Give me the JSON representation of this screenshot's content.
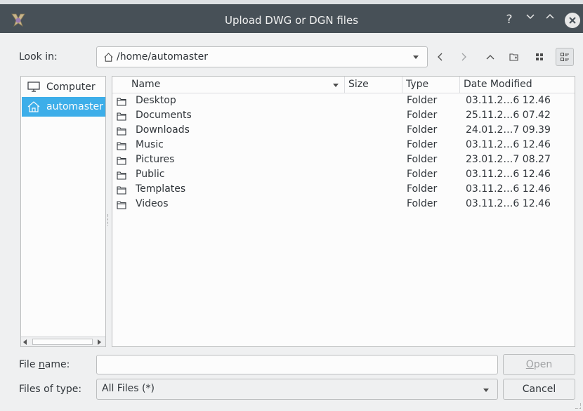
{
  "window": {
    "title": "Upload DWG or DGN files",
    "help_glyph": "?",
    "minimize_glyph": "⌄",
    "maximize_glyph": "⌃"
  },
  "lookin": {
    "label": "Look in:",
    "path": "/home/automaster"
  },
  "sidebar": {
    "items": [
      {
        "label": "Computer",
        "icon": "computer-icon"
      },
      {
        "label": "automaster",
        "icon": "home-icon"
      }
    ]
  },
  "filelist": {
    "columns": [
      "Name",
      "Size",
      "Type",
      "Date Modified"
    ],
    "rows": [
      {
        "name": "Desktop",
        "size": "",
        "type": "Folder",
        "date": "03.11.2…6 12.46"
      },
      {
        "name": "Documents",
        "size": "",
        "type": "Folder",
        "date": "25.11.2…6 07.42"
      },
      {
        "name": "Downloads",
        "size": "",
        "type": "Folder",
        "date": "24.01.2…7 09.39"
      },
      {
        "name": "Music",
        "size": "",
        "type": "Folder",
        "date": "03.11.2…6 12.46"
      },
      {
        "name": "Pictures",
        "size": "",
        "type": "Folder",
        "date": "23.01.2…7 08.27"
      },
      {
        "name": "Public",
        "size": "",
        "type": "Folder",
        "date": "03.11.2…6 12.46"
      },
      {
        "name": "Templates",
        "size": "",
        "type": "Folder",
        "date": "03.11.2…6 12.46"
      },
      {
        "name": "Videos",
        "size": "",
        "type": "Folder",
        "date": "03.11.2…6 12.46"
      }
    ]
  },
  "bottom": {
    "filename_label": "File name:",
    "filename_value": "",
    "open_label": "Open",
    "filetype_label": "Files of type:",
    "filetype_value": "All Files (*)",
    "cancel_label": "Cancel"
  },
  "colors": {
    "titlebar": "#475057",
    "selection": "#3daee9",
    "window_bg": "#eff0f1",
    "view_bg": "#fcfcfc"
  }
}
